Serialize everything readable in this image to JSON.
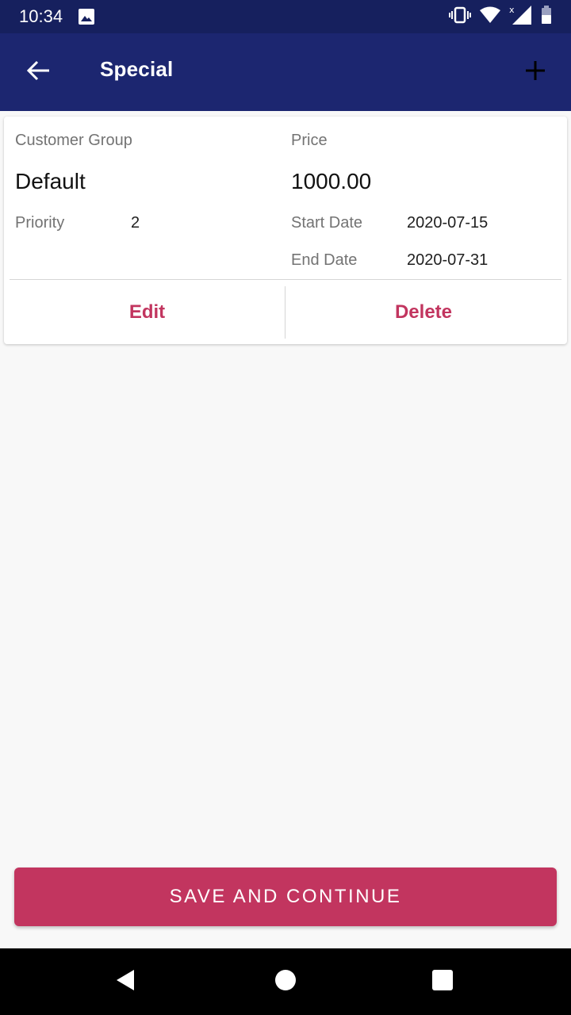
{
  "status_bar": {
    "time": "10:34",
    "icons": [
      "image-icon",
      "vibrate-icon",
      "wifi-icon",
      "signal-icon",
      "battery-icon"
    ]
  },
  "app_bar": {
    "title": "Special",
    "back_icon": "arrow-left-icon",
    "add_icon": "plus-icon"
  },
  "special_card": {
    "customer_group_label": "Customer Group",
    "customer_group_value": "Default",
    "price_label": "Price",
    "price_value": "1000.00",
    "priority_label": "Priority",
    "priority_value": "2",
    "start_date_label": "Start Date",
    "start_date_value": "2020-07-15",
    "end_date_label": "End Date",
    "end_date_value": "2020-07-31",
    "edit_label": "Edit",
    "delete_label": "Delete"
  },
  "footer": {
    "save_label": "SAVE AND CONTINUE"
  },
  "colors": {
    "status_bar": "#16205e",
    "app_bar": "#1c2670",
    "accent": "#c2355f",
    "background": "#f8f8f8"
  },
  "nav_bar": {
    "icons": [
      "back-triangle-icon",
      "home-circle-icon",
      "recents-square-icon"
    ]
  }
}
